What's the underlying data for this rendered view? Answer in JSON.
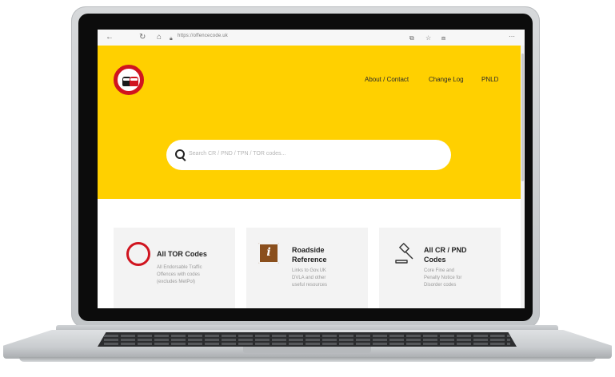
{
  "browser": {
    "url": "https://offencecode.uk"
  },
  "header": {
    "nav": [
      {
        "label": "About / Contact"
      },
      {
        "label": "Change Log"
      },
      {
        "label": "PNLD"
      }
    ]
  },
  "search": {
    "placeholder": "Search CR / PND / TPN / TOR codes..."
  },
  "cards": [
    {
      "title_line1": "All TOR Codes",
      "title_line2": "",
      "desc": [
        "All Endorsable Traffic",
        "Offences with codes",
        "(excludes MetPol)"
      ],
      "icon": "red-ring-icon"
    },
    {
      "title_line1": "Roadside",
      "title_line2": "Reference",
      "desc": [
        "Links to Gov.UK",
        "DVLA and other",
        "useful resources"
      ],
      "icon": "info-icon"
    },
    {
      "title_line1": "All CR / PND",
      "title_line2": "Codes",
      "desc": [
        "Core Fine and",
        "Penalty Notice for",
        "Disorder codes"
      ],
      "icon": "gavel-icon"
    }
  ],
  "colors": {
    "hero": "#ffd000",
    "accent_red": "#d0141f"
  }
}
